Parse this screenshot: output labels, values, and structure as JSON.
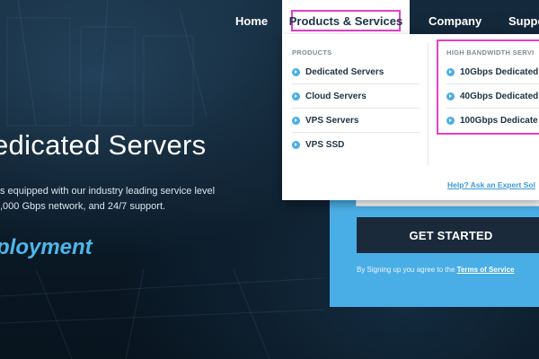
{
  "nav": {
    "home": "Home",
    "products_services": "Products & Services",
    "company": "Company",
    "support": "Suppo"
  },
  "hero": {
    "title": "edicated Servers",
    "desc_line1": "s equipped with our industry leading service level",
    "desc_line2": ",000 Gbps network, and 24/7 support.",
    "deployment": "ployment"
  },
  "dropdown": {
    "products_heading": "PRODUCTS",
    "products": [
      {
        "label": "Dedicated Servers"
      },
      {
        "label": "Cloud Servers"
      },
      {
        "label": "VPS Servers"
      },
      {
        "label": "VPS SSD"
      }
    ],
    "high_bandwidth_heading": "HIGH BANDWIDTH SERVI",
    "high_bandwidth": [
      {
        "label": "10Gbps Dedicated"
      },
      {
        "label": "40Gbps Dedicated"
      },
      {
        "label": "100Gbps Dedicate"
      }
    ],
    "expert_link": "Help? Ask an Expert Sol"
  },
  "signup": {
    "email_value": "",
    "button": "GET STARTED",
    "agree_prefix": "By Signing up you agree to the ",
    "tos": "Terms of Service"
  },
  "colors": {
    "accent": "#4aaee6",
    "highlight": "#e33fc8",
    "button_dark": "#1a2a3a"
  }
}
